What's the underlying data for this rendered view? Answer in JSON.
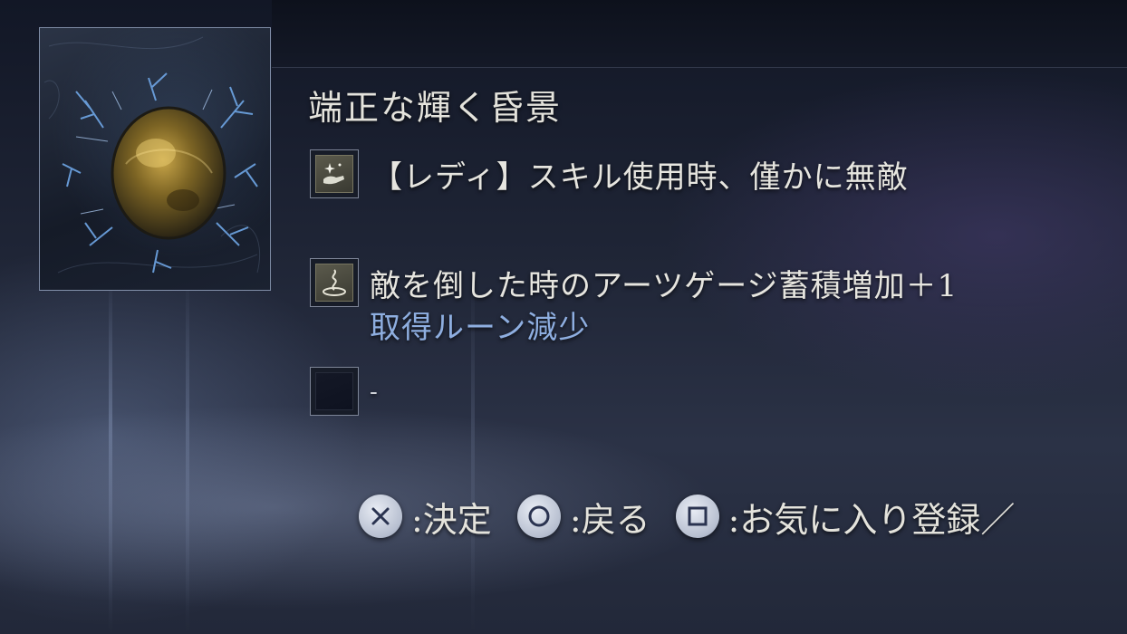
{
  "item": {
    "name": "端正な輝く昏景",
    "image_icon": "relic-gem-icon"
  },
  "effects": [
    {
      "icon": "hand-sparkle-icon",
      "text": "【レディ】スキル使用時、僅かに無敵",
      "sub": ""
    },
    {
      "icon": "spiral-rise-icon",
      "text": "敵を倒した時のアーツゲージ蓄積増加＋1",
      "sub": "取得ルーン減少"
    },
    {
      "icon": "empty-slot-icon",
      "text": "-",
      "sub": ""
    }
  ],
  "controls": [
    {
      "button": "cross-button-icon",
      "label": ":決定"
    },
    {
      "button": "circle-button-icon",
      "label": ":戻る"
    },
    {
      "button": "square-button-icon",
      "label": ":お気に入り登録／"
    }
  ],
  "colors": {
    "text": "#e4e3dc",
    "sub_text": "#8eaee0",
    "frame": "#aab9d7"
  }
}
